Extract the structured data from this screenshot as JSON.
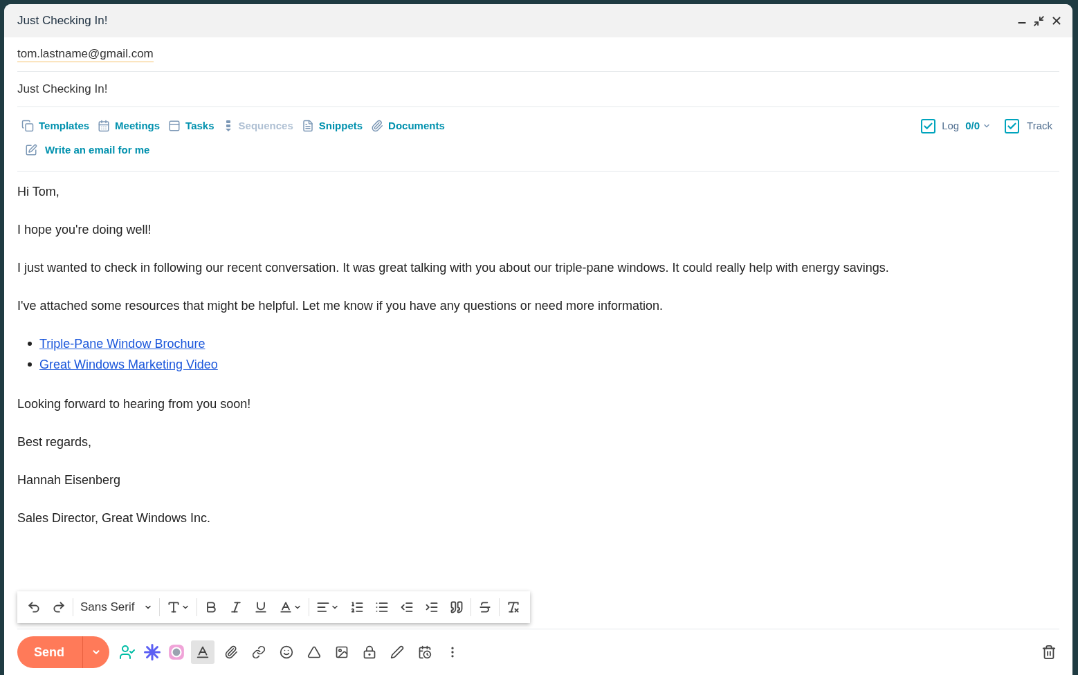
{
  "window": {
    "title": "Just Checking In!"
  },
  "recipient": "tom.lastname@gmail.com",
  "subject": "Just Checking In!",
  "tools": [
    {
      "label": "Templates",
      "disabled": false
    },
    {
      "label": "Meetings",
      "disabled": false
    },
    {
      "label": "Tasks",
      "disabled": false
    },
    {
      "label": "Sequences",
      "disabled": true
    },
    {
      "label": "Snippets",
      "disabled": false
    },
    {
      "label": "Documents",
      "disabled": false
    }
  ],
  "ai_tool": {
    "label": "Write an email for me"
  },
  "log": {
    "label": "Log",
    "count": "0/0",
    "checked": true
  },
  "track": {
    "label": "Track",
    "checked": true
  },
  "body": [
    {
      "kind": "paragraph",
      "text": "Hi Tom,"
    },
    {
      "kind": "paragraph",
      "text": "I hope you're doing well!"
    },
    {
      "kind": "paragraph",
      "text": "I just wanted to check in following our recent conversation. It was great talking with you about our triple-pane windows. It could really help with energy savings."
    },
    {
      "kind": "paragraph",
      "text": "I've attached some resources that might be helpful. Let me know if you have any questions or need more information."
    },
    {
      "kind": "links",
      "items": [
        "Triple-Pane Window Brochure",
        "Great Windows Marketing Video"
      ]
    },
    {
      "kind": "paragraph",
      "text": "Looking forward to hearing from you soon!"
    },
    {
      "kind": "paragraph",
      "text": "Best regards,"
    },
    {
      "kind": "paragraph",
      "text": "Hannah Eisenberg"
    },
    {
      "kind": "paragraph",
      "text": "Sales Director, Great Windows Inc."
    }
  ],
  "format_toolbar": {
    "font": "Sans Serif"
  },
  "send": {
    "label": "Send"
  }
}
